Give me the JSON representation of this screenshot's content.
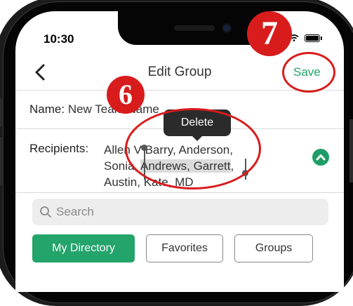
{
  "status_bar": {
    "time": "10:30"
  },
  "navbar": {
    "title": "Edit Group",
    "save_label": "Save"
  },
  "name_field": {
    "label": "Name:",
    "value": "New Team Name"
  },
  "recipients": {
    "label": "Recipients:",
    "line1": "Allen V Barry, Anderson,",
    "line2_prefix": "Sonia, ",
    "line2_selected": "Andrews, Garrett",
    "line2_suffix": ",",
    "line3": "Austin, Kate, MD"
  },
  "context_menu": {
    "delete_label": "Delete"
  },
  "search": {
    "placeholder": "Search"
  },
  "tabs": [
    {
      "label": "My Directory",
      "active": true
    },
    {
      "label": "Favorites",
      "active": false
    },
    {
      "label": "Groups",
      "active": false
    }
  ],
  "callouts": {
    "step_a": "6",
    "step_b": "7"
  },
  "colors": {
    "accent": "#23a46a",
    "callout": "#d81c1c",
    "tooltip": "#2b2b2b"
  },
  "icons": [
    "back-chevron-icon",
    "wifi-icon",
    "battery-icon",
    "collapse-up-icon",
    "search-icon"
  ]
}
